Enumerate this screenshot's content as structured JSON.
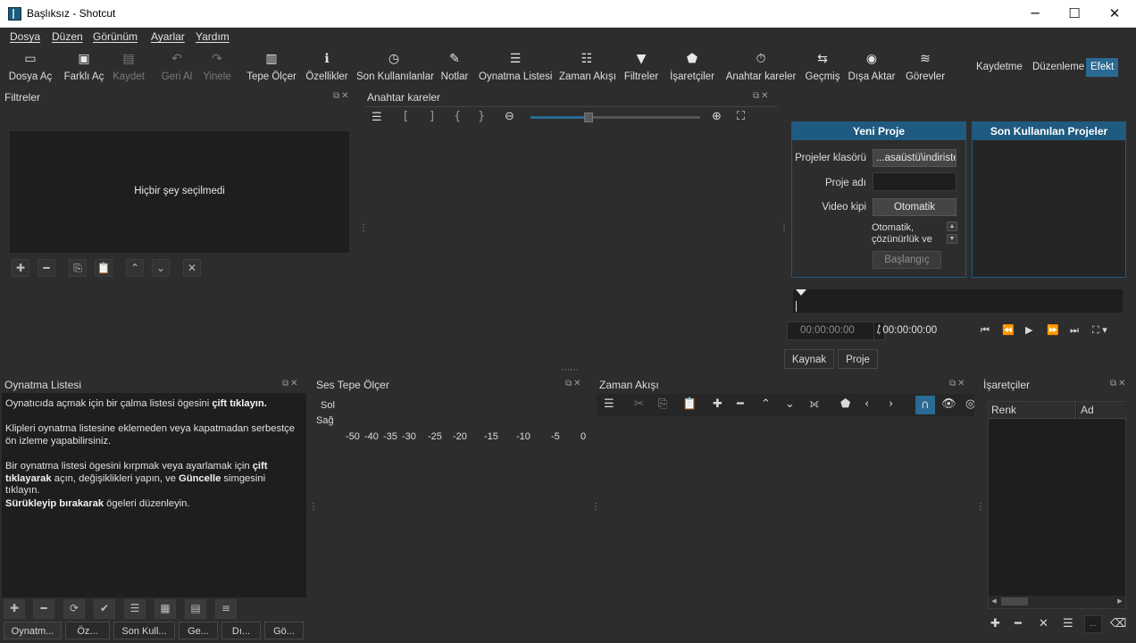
{
  "window": {
    "title": "Başlıksız - Shotcut",
    "minimize_glyph": "─",
    "maximize_glyph": "☐",
    "close_glyph": "✕"
  },
  "menu": [
    "Dosya",
    "Düzen",
    "Görünüm",
    "Ayarlar",
    "Yardım"
  ],
  "toolbar": {
    "open_file": "Dosya Aç",
    "open_other": "Farklı Aç",
    "save": "Kaydet",
    "undo": "Geri Al",
    "redo": "Yinele",
    "peak_meter": "Tepe Ölçer",
    "properties": "Özellikler",
    "recent": "Son Kullanılanlar",
    "notes": "Notlar",
    "playlist": "Oynatma Listesi",
    "timeline": "Zaman Akışı",
    "filters": "Filtreler",
    "markers": "İşaretçiler",
    "keyframes": "Anahtar kareler",
    "history": "Geçmiş",
    "export": "Dışa Aktar",
    "jobs": "Görevler"
  },
  "layouts": {
    "logging": "Kaydetme",
    "editing": "Düzenleme",
    "effects": "Efekt",
    "active": "Efekt"
  },
  "filters_panel": {
    "title": "Filtreler",
    "empty_text": "Hiçbir şey seçilmedi"
  },
  "keyframes_panel": {
    "title": "Anahtar kareler"
  },
  "start_panel": {
    "new_project_header": "Yeni Proje",
    "recent_projects_header": "Son Kullanılan Projeler",
    "projects_folder_label": "Projeler klasörü",
    "projects_folder_value": "...asaüstü\\indiriste",
    "project_name_label": "Proje adı",
    "project_name_value": "",
    "video_mode_label": "Video kipi",
    "video_mode_value": "Otomatik",
    "auto_note": "Otomatik, çözünürlük ve",
    "start_button": "Başlangıç"
  },
  "player": {
    "timecode": "00:00:00:00",
    "duration": "/ 00:00:00:00",
    "tabs": {
      "source": "Kaynak",
      "project": "Proje"
    }
  },
  "playlist_panel": {
    "title": "Oynatma Listesi",
    "p1_pre": "Oynatıcıda açmak için bir çalma listesi ögesini ",
    "p1_bold": "çift tıklayın.",
    "p2": "Klipleri oynatma listesine eklemeden veya kapatmadan serbestçe ön izleme yapabilirsiniz.",
    "p3_pre": "Bir oynatma listesi ögesini kırpmak veya ayarlamak için ",
    "p3_bold1": "çift tıklayarak",
    "p3_mid": " açın, değişiklikleri yapın, ve ",
    "p3_bold2": "Güncelle",
    "p3_post": " simgesini tıklayın.",
    "p4_bold": "Sürükleyip bırakarak",
    "p4_post": " ögeleri düzenleyin."
  },
  "bottom_tabs": [
    "Oynatm...",
    "Öz...",
    "Son Kull...",
    "Ge...",
    "Dı...",
    "Gö..."
  ],
  "audio_panel": {
    "title": "Ses Tepe Ölçer",
    "left": "Sol",
    "right": "Sağ",
    "scale": [
      "-50",
      "-40",
      "-35",
      "-30",
      "-25",
      "-20",
      "-15",
      "-10",
      "-5",
      "0"
    ]
  },
  "timeline_panel": {
    "title": "Zaman Akışı"
  },
  "markers_panel": {
    "title": "İşaretçiler",
    "col_color": "Renk",
    "col_name": "Ad",
    "more": "..."
  },
  "colors": {
    "accent": "#2a6a94",
    "header_blue": "#1f5a80",
    "background": "#2d2d2d",
    "panel": "#1e1e1e"
  }
}
